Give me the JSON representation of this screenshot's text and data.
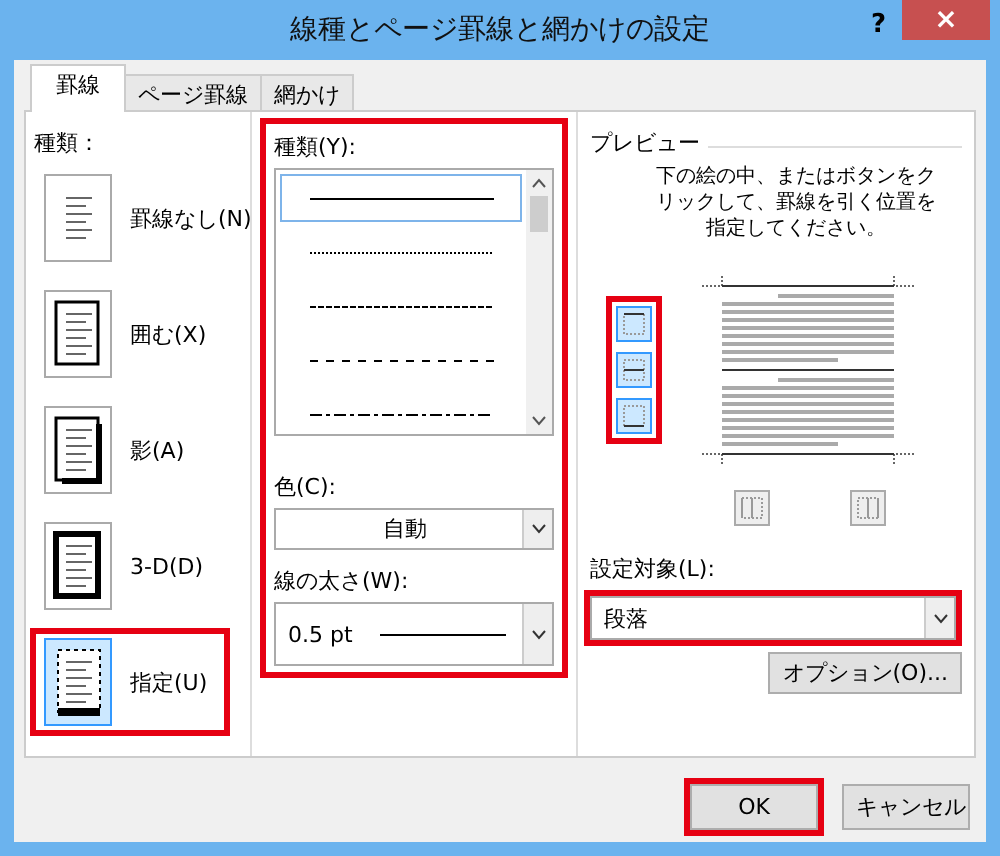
{
  "window": {
    "title": "線種とページ罫線と網かけの設定",
    "help": "?",
    "close": "×"
  },
  "tabs": [
    {
      "label": "罫線",
      "selected": true
    },
    {
      "label": "ページ罫線",
      "selected": false
    },
    {
      "label": "網かけ",
      "selected": false
    }
  ],
  "setting": {
    "label": "種類：",
    "items": [
      {
        "kind": "none",
        "label": "罫線なし(N)",
        "selected": false,
        "highlighted": false
      },
      {
        "kind": "box",
        "label": "囲む(X)",
        "selected": false,
        "highlighted": false
      },
      {
        "kind": "shadow",
        "label": "影(A)",
        "selected": false,
        "highlighted": false
      },
      {
        "kind": "threed",
        "label": "3-D(D)",
        "selected": false,
        "highlighted": false
      },
      {
        "kind": "custom",
        "label": "指定(U)",
        "selected": true,
        "highlighted": true
      }
    ]
  },
  "style": {
    "label": "種類(Y):",
    "highlighted": true,
    "items": [
      {
        "kind": "solid",
        "selected": true
      },
      {
        "kind": "dotted",
        "selected": false
      },
      {
        "kind": "dashed",
        "selected": false
      },
      {
        "kind": "longdash",
        "selected": false
      },
      {
        "kind": "dashdot",
        "selected": false
      }
    ],
    "color": {
      "label": "色(C):",
      "value": "自動"
    },
    "width": {
      "label": "線の太さ(W):",
      "value": "0.5 pt"
    }
  },
  "preview": {
    "title": "プレビュー",
    "instructions": "下の絵の中、またはボタンをクリックして、罫線を引く位置を指定してください。",
    "side_buttons_highlighted": true,
    "side_buttons": [
      {
        "kind": "top",
        "selected": true
      },
      {
        "kind": "middle",
        "selected": true
      },
      {
        "kind": "bottom",
        "selected": true
      }
    ],
    "bottom_buttons": [
      {
        "kind": "left",
        "selected": false
      },
      {
        "kind": "right",
        "selected": false
      }
    ]
  },
  "apply_to": {
    "label": "設定対象(L):",
    "value": "段落",
    "highlighted": true
  },
  "options_button": "オプション(O)...",
  "buttons": [
    {
      "label": "OK",
      "highlighted": true
    },
    {
      "label": "キャンセル",
      "highlighted": false
    }
  ]
}
